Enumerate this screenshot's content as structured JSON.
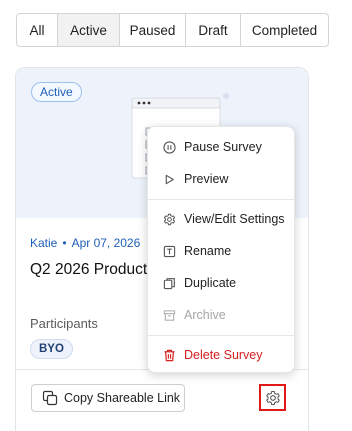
{
  "filters": {
    "tabs": [
      {
        "label": "All",
        "selected": false
      },
      {
        "label": "Active",
        "selected": true
      },
      {
        "label": "Paused",
        "selected": false
      },
      {
        "label": "Draft",
        "selected": false
      },
      {
        "label": "Completed",
        "selected": false
      }
    ]
  },
  "card": {
    "status": "Active",
    "author": "Katie",
    "separator": "•",
    "date": "Apr 07, 2026",
    "title": "Q2 2026 Product",
    "participants_label": "Participants",
    "participants_tag": "BYO",
    "copy_link_label": "Copy Shareable Link",
    "settings_icon": "gear-icon"
  },
  "menu": {
    "items": [
      {
        "label": "Pause Survey",
        "icon": "pause-circle-icon"
      },
      {
        "label": "Preview",
        "icon": "play-icon"
      },
      {
        "label": "View/Edit Settings",
        "icon": "gear-icon"
      },
      {
        "label": "Rename",
        "icon": "text-box-icon"
      },
      {
        "label": "Duplicate",
        "icon": "copy-icon"
      },
      {
        "label": "Archive",
        "icon": "archive-icon",
        "disabled": true
      },
      {
        "label": "Delete Survey",
        "icon": "trash-icon",
        "danger": true
      }
    ]
  },
  "colors": {
    "accent": "#1f5fb8",
    "danger": "#d32020",
    "highlight_box": "#e01818",
    "hero_bg": "#eef3fb"
  }
}
